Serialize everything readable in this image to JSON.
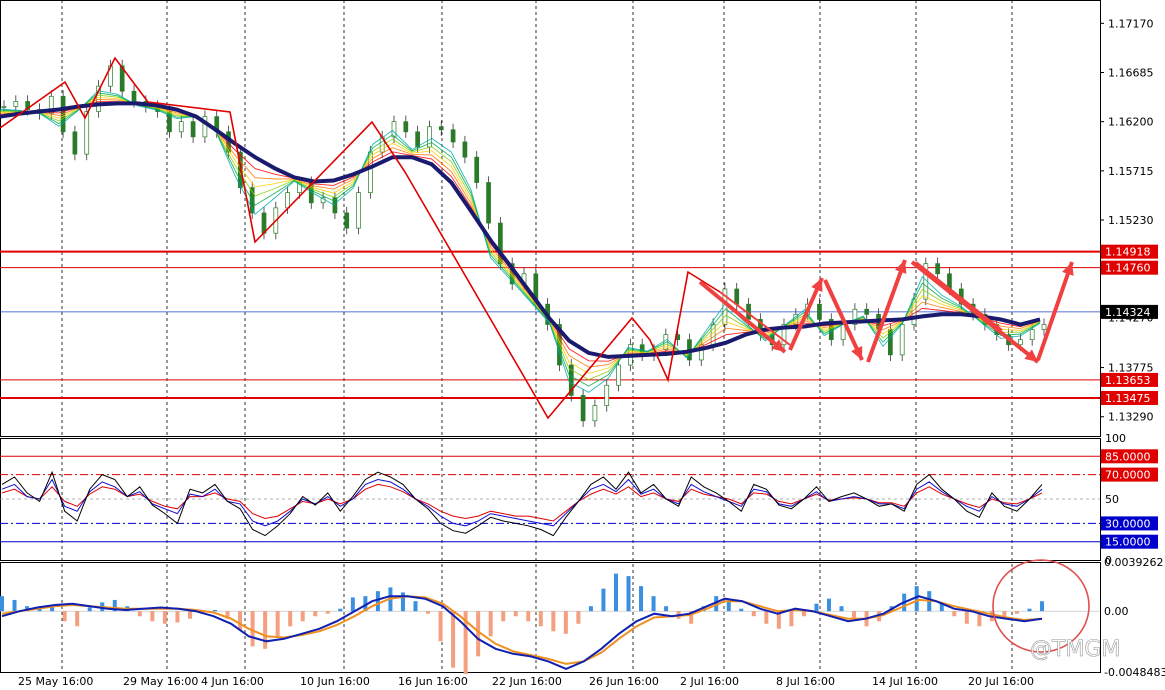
{
  "chart_data": {
    "type": "line",
    "title": "",
    "x_ticks": [
      "25 May 16:00",
      "29 May 16:00",
      "4 Jun 16:00",
      "10 Jun 16:00",
      "16 Jun 16:00",
      "22 Jun 16:00",
      "26 Jun 16:00",
      "2 Jul 16:00",
      "8 Jul 16:00",
      "14 Jul 16:00",
      "20 Jul 16:00"
    ],
    "price": {
      "ylim": [
        1.329,
        1.1717
      ],
      "ylim_note": "",
      "ylim_values": [
        1.13,
        1.1755
      ],
      "y_ticks": [
        "1.17170",
        "1.16685",
        "1.16200",
        "1.15715",
        "1.15230",
        "1.14270",
        "1.13775",
        "1.13290"
      ],
      "y_tick_values": [
        1.1717,
        1.16685,
        1.162,
        1.15715,
        1.1523,
        1.1427,
        1.13775,
        1.1329
      ],
      "levels": [
        {
          "label": "1.14918",
          "value": 1.14918,
          "color": "#e00000"
        },
        {
          "label": "1.14760",
          "value": 1.1476,
          "color": "#e00000"
        },
        {
          "label": "1.13653",
          "value": 1.13653,
          "color": "#e00000"
        },
        {
          "label": "1.13475",
          "value": 1.13475,
          "color": "#e00000"
        }
      ],
      "current": {
        "label": "1.14324",
        "value": 1.14324,
        "color": "#000000"
      },
      "close_series": [
        1.1635,
        1.164,
        1.1632,
        1.1628,
        1.1645,
        1.161,
        1.1588,
        1.163,
        1.1655,
        1.1675,
        1.165,
        1.164,
        1.1635,
        1.163,
        1.161,
        1.162,
        1.1605,
        1.1625,
        1.161,
        1.159,
        1.1555,
        1.153,
        1.151,
        1.1535,
        1.155,
        1.156,
        1.154,
        1.1545,
        1.153,
        1.1515,
        1.155,
        1.159,
        1.1605,
        1.162,
        1.161,
        1.1595,
        1.1615,
        1.1612,
        1.16,
        1.1585,
        1.156,
        1.152,
        1.148,
        1.146,
        1.147,
        1.144,
        1.142,
        1.138,
        1.135,
        1.1325,
        1.134,
        1.136,
        1.138,
        1.14,
        1.139,
        1.1395,
        1.141,
        1.1405,
        1.1385,
        1.14,
        1.142,
        1.1455,
        1.144,
        1.1425,
        1.141,
        1.14,
        1.142,
        1.143,
        1.144,
        1.1425,
        1.1405,
        1.142,
        1.1435,
        1.143,
        1.1415,
        1.139,
        1.142,
        1.1445,
        1.148,
        1.147,
        1.1455,
        1.144,
        1.143,
        1.142,
        1.141,
        1.14,
        1.1405,
        1.1415,
        1.142
      ],
      "ma_series": [
        1.1625,
        1.1628,
        1.163,
        1.1632,
        1.1635,
        1.1637,
        1.1638,
        1.1638,
        1.1636,
        1.1632,
        1.1625,
        1.1612,
        1.1598,
        1.1585,
        1.1574,
        1.1565,
        1.1561,
        1.1562,
        1.1568,
        1.1576,
        1.1585,
        1.1585,
        1.1578,
        1.156,
        1.1532,
        1.1503,
        1.1478,
        1.1452,
        1.1426,
        1.1404,
        1.1392,
        1.1388,
        1.1389,
        1.139,
        1.1391,
        1.1393,
        1.1397,
        1.1402,
        1.141,
        1.1415,
        1.1417,
        1.1418,
        1.1421,
        1.1422,
        1.1423,
        1.1424,
        1.1425,
        1.1428,
        1.143,
        1.143,
        1.1428,
        1.1425,
        1.142,
        1.1425
      ]
    },
    "oscillator": {
      "y_ticks": [
        "100",
        "85.0000",
        "70.0000",
        "50",
        "30.0000",
        "15.0000",
        "0"
      ],
      "levels": [
        {
          "label": "85.0000",
          "value": 85,
          "color": "#e00000"
        },
        {
          "label": "70.0000",
          "value": 70,
          "color": "#e00000"
        },
        {
          "label": "30.0000",
          "value": 30,
          "color": "#0000cc"
        },
        {
          "label": "15.0000",
          "value": 15,
          "color": "#0000cc"
        }
      ],
      "series_black": [
        62,
        68,
        55,
        48,
        72,
        40,
        32,
        58,
        70,
        66,
        52,
        60,
        45,
        38,
        30,
        58,
        55,
        62,
        48,
        42,
        25,
        20,
        28,
        38,
        52,
        45,
        55,
        40,
        52,
        66,
        72,
        68,
        62,
        50,
        42,
        30,
        24,
        22,
        28,
        35,
        32,
        30,
        28,
        25,
        20,
        35,
        48,
        62,
        68,
        58,
        72,
        55,
        62,
        50,
        44,
        68,
        60,
        55,
        48,
        40,
        62,
        58,
        45,
        42,
        50,
        60,
        48,
        52,
        55,
        50,
        44,
        46,
        40,
        62,
        70,
        58,
        50,
        40,
        35,
        55,
        44,
        40,
        50,
        62
      ],
      "series_blue": [
        58,
        62,
        52,
        50,
        66,
        44,
        40,
        56,
        64,
        60,
        52,
        56,
        46,
        42,
        38,
        54,
        52,
        58,
        48,
        46,
        32,
        28,
        32,
        40,
        50,
        46,
        52,
        44,
        50,
        62,
        66,
        64,
        58,
        50,
        44,
        36,
        30,
        28,
        32,
        38,
        36,
        34,
        32,
        30,
        28,
        38,
        48,
        58,
        62,
        56,
        66,
        54,
        58,
        50,
        46,
        62,
        56,
        52,
        48,
        44,
        58,
        56,
        46,
        44,
        50,
        56,
        48,
        50,
        52,
        50,
        46,
        46,
        42,
        58,
        64,
        56,
        50,
        44,
        40,
        52,
        46,
        44,
        50,
        58
      ],
      "series_red": [
        55,
        58,
        52,
        50,
        60,
        48,
        44,
        54,
        60,
        58,
        52,
        54,
        48,
        44,
        42,
        52,
        52,
        55,
        50,
        48,
        38,
        34,
        36,
        42,
        48,
        46,
        50,
        46,
        50,
        58,
        62,
        60,
        56,
        50,
        46,
        40,
        36,
        34,
        36,
        40,
        38,
        36,
        36,
        34,
        32,
        40,
        48,
        54,
        58,
        54,
        60,
        52,
        55,
        50,
        48,
        58,
        54,
        52,
        50,
        46,
        55,
        54,
        48,
        46,
        50,
        54,
        49,
        50,
        51,
        50,
        47,
        47,
        44,
        55,
        60,
        54,
        50,
        46,
        43,
        50,
        47,
        46,
        50,
        55
      ]
    },
    "macd": {
      "y_ticks": [
        "0.0039262",
        "0.00",
        "-0.0048483"
      ],
      "ylim": [
        -0.0048483,
        0.0039262
      ],
      "histogram": [
        0.0012,
        0.0009,
        0.0004,
        0.0002,
        0.0003,
        -0.0008,
        -0.0012,
        0.0003,
        0.0007,
        0.0009,
        0.0004,
        -0.0004,
        -0.0008,
        -0.001,
        -0.0009,
        -0.0006,
        -0.0002,
        0.0001,
        -0.0006,
        -0.0015,
        -0.0028,
        -0.003,
        -0.002,
        -0.0012,
        -0.0008,
        -0.0004,
        -0.0002,
        0.0002,
        0.0011,
        0.0012,
        0.0016,
        0.0019,
        0.0015,
        0.0008,
        -0.0002,
        -0.0024,
        -0.0045,
        -0.005,
        -0.0036,
        -0.002,
        -0.0008,
        -0.0004,
        -0.0008,
        -0.0012,
        -0.0016,
        -0.0018,
        -0.001,
        0.0004,
        0.0018,
        0.003,
        0.0028,
        0.002,
        0.0012,
        0.0004,
        -0.0006,
        -0.001,
        0.0004,
        0.0012,
        0.0008,
        0.0002,
        -0.0004,
        -0.001,
        -0.0014,
        -0.0012,
        -0.0004,
        0.0006,
        0.001,
        0.0004,
        -0.0006,
        -0.0012,
        -0.0008,
        0.0004,
        0.0014,
        0.002,
        0.0016,
        0.0006,
        -0.0004,
        -0.001,
        -0.0012,
        -0.0008,
        -0.0004,
        -0.0002,
        0.0002,
        0.0008
      ],
      "macd_line": [
        -0.0004,
        0.0,
        0.0003,
        0.0005,
        0.0006,
        0.0004,
        0.0002,
        0.0001,
        0.0002,
        0.0003,
        0.0002,
        0.0,
        -0.0004,
        -0.001,
        -0.002,
        -0.0024,
        -0.0022,
        -0.0018,
        -0.0014,
        -0.0008,
        0.0,
        0.0008,
        0.0012,
        0.0012,
        0.001,
        0.0004,
        -0.0008,
        -0.0022,
        -0.003,
        -0.0034,
        -0.0036,
        -0.004,
        -0.0046,
        -0.004,
        -0.003,
        -0.0018,
        -0.0008,
        -0.0002,
        -0.0004,
        -0.0002,
        0.0004,
        0.001,
        0.0008,
        0.0002,
        -0.0002,
        0.0002,
        0.0,
        -0.0004,
        -0.0008,
        -0.0006,
        -0.0002,
        0.0006,
        0.0012,
        0.0008,
        0.0002,
        0.0,
        -0.0004,
        -0.0006,
        -0.0008,
        -0.0006
      ],
      "signal_line": [
        -0.0002,
        0.0,
        0.0002,
        0.0004,
        0.0005,
        0.0004,
        0.0003,
        0.0002,
        0.0002,
        0.0002,
        0.0002,
        0.0001,
        -0.0001,
        -0.0006,
        -0.0014,
        -0.002,
        -0.0021,
        -0.0019,
        -0.0016,
        -0.0011,
        -0.0004,
        0.0004,
        0.001,
        0.0012,
        0.0011,
        0.0006,
        -0.0004,
        -0.0016,
        -0.0026,
        -0.0032,
        -0.0035,
        -0.0038,
        -0.0042,
        -0.004,
        -0.0033,
        -0.0022,
        -0.0012,
        -0.0005,
        -0.0004,
        -0.0003,
        0.0002,
        0.0008,
        0.0008,
        0.0004,
        0.0,
        0.0001,
        0.0,
        -0.0003,
        -0.0006,
        -0.0006,
        -0.0003,
        0.0003,
        0.0009,
        0.0008,
        0.0004,
        0.0001,
        -0.0002,
        -0.0005,
        -0.0007,
        -0.0006
      ]
    }
  },
  "watermark": "@TMGM",
  "colors": {
    "grid": "#000000",
    "level_red": "#e00000",
    "level_blue": "#0000cc",
    "ma": "#1a1a6e",
    "current_line": "#2244cc",
    "arrow": "#f04040",
    "hist_pos": "#3a8fe0",
    "hist_neg": "#f4a080",
    "macd": "#1020b0",
    "signal": "#f09020"
  }
}
